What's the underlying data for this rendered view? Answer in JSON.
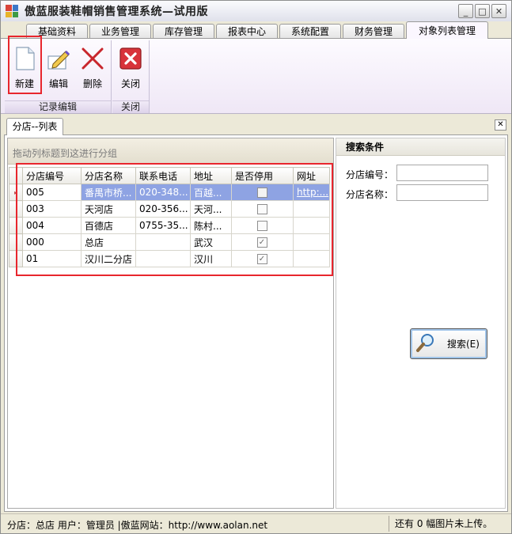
{
  "window": {
    "title": "傲蓝服装鞋帽销售管理系统—试用版",
    "controls": {
      "minimize": "_",
      "maximize": "□",
      "close": "✕"
    }
  },
  "ribbon_tabs": [
    "基础资料",
    "业务管理",
    "库存管理",
    "报表中心",
    "系统配置",
    "财务管理",
    "对象列表管理"
  ],
  "ribbon": {
    "groups": [
      {
        "label": "记录编辑",
        "buttons": [
          {
            "label": "新建",
            "icon": "new-document-icon"
          },
          {
            "label": "编辑",
            "icon": "edit-pencil-icon"
          },
          {
            "label": "删除",
            "icon": "delete-x-icon"
          }
        ]
      },
      {
        "label": "关闭",
        "buttons": [
          {
            "label": "关闭",
            "icon": "close-red-icon"
          }
        ]
      }
    ]
  },
  "document_tab": {
    "label": "分店--列表",
    "close": "✕"
  },
  "grid": {
    "group_hint": "拖动列标题到这进行分组",
    "columns": [
      "分店编号",
      "分店名称",
      "联系电话",
      "地址",
      "是否停用",
      "网址"
    ],
    "rows": [
      {
        "code": "005",
        "name": "番禺市桥...",
        "phone": "020-348...",
        "address": "百越...",
        "disabled": false,
        "url": "http:..."
      },
      {
        "code": "003",
        "name": "天河店",
        "phone": "020-356...",
        "address": "天河...",
        "disabled": false,
        "url": ""
      },
      {
        "code": "004",
        "name": "百德店",
        "phone": "0755-35...",
        "address": "陈村...",
        "disabled": false,
        "url": ""
      },
      {
        "code": "000",
        "name": "总店",
        "phone": "",
        "address": "武汉",
        "disabled": true,
        "url": ""
      },
      {
        "code": "01",
        "name": "汉川二分店",
        "phone": "",
        "address": "汉川",
        "disabled": true,
        "url": ""
      }
    ]
  },
  "search": {
    "title": "搜索条件",
    "fields": [
      {
        "label": "分店编号：",
        "value": ""
      },
      {
        "label": "分店名称：",
        "value": ""
      }
    ],
    "button_label": "搜索(E)",
    "button_icon": "magnifier-icon"
  },
  "status": {
    "left": "分店：总店  用户：管理员  |傲蓝网站：http://www.aolan.net",
    "right": "还有 0 幅图片未上传。"
  },
  "colors": {
    "selection": "#8ea3e3",
    "highlight_box": "#e8262d",
    "ribbon_bg": "#efe7f6"
  }
}
